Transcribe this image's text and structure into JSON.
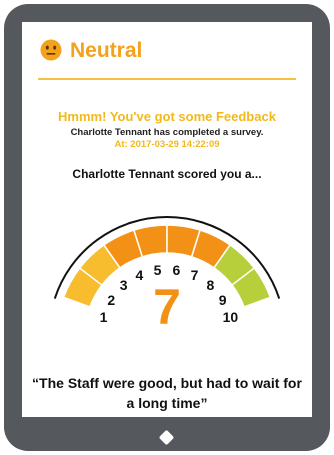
{
  "header": {
    "mood_label": "Neutral",
    "mood_icon": "neutral-face-icon"
  },
  "feedback": {
    "title": "Hmmm! You've got some Feedback",
    "subtitle": "Charlotte Tennant has completed a survey.",
    "timestamp": "At: 2017-03-29  14:22:09"
  },
  "score": {
    "intro": "Charlotte Tennant scored you a...",
    "value": "7",
    "scale": [
      "1",
      "2",
      "3",
      "4",
      "5",
      "6",
      "7",
      "8",
      "9",
      "10"
    ]
  },
  "quote": "“The Staff were good, but had to wait for a long time”",
  "colors": {
    "accent": "#f4a11c",
    "gauge_orange": "#f39116",
    "gauge_yellow": "#f8bd2e",
    "gauge_green": "#b7cf3a",
    "device": "#55585c"
  }
}
